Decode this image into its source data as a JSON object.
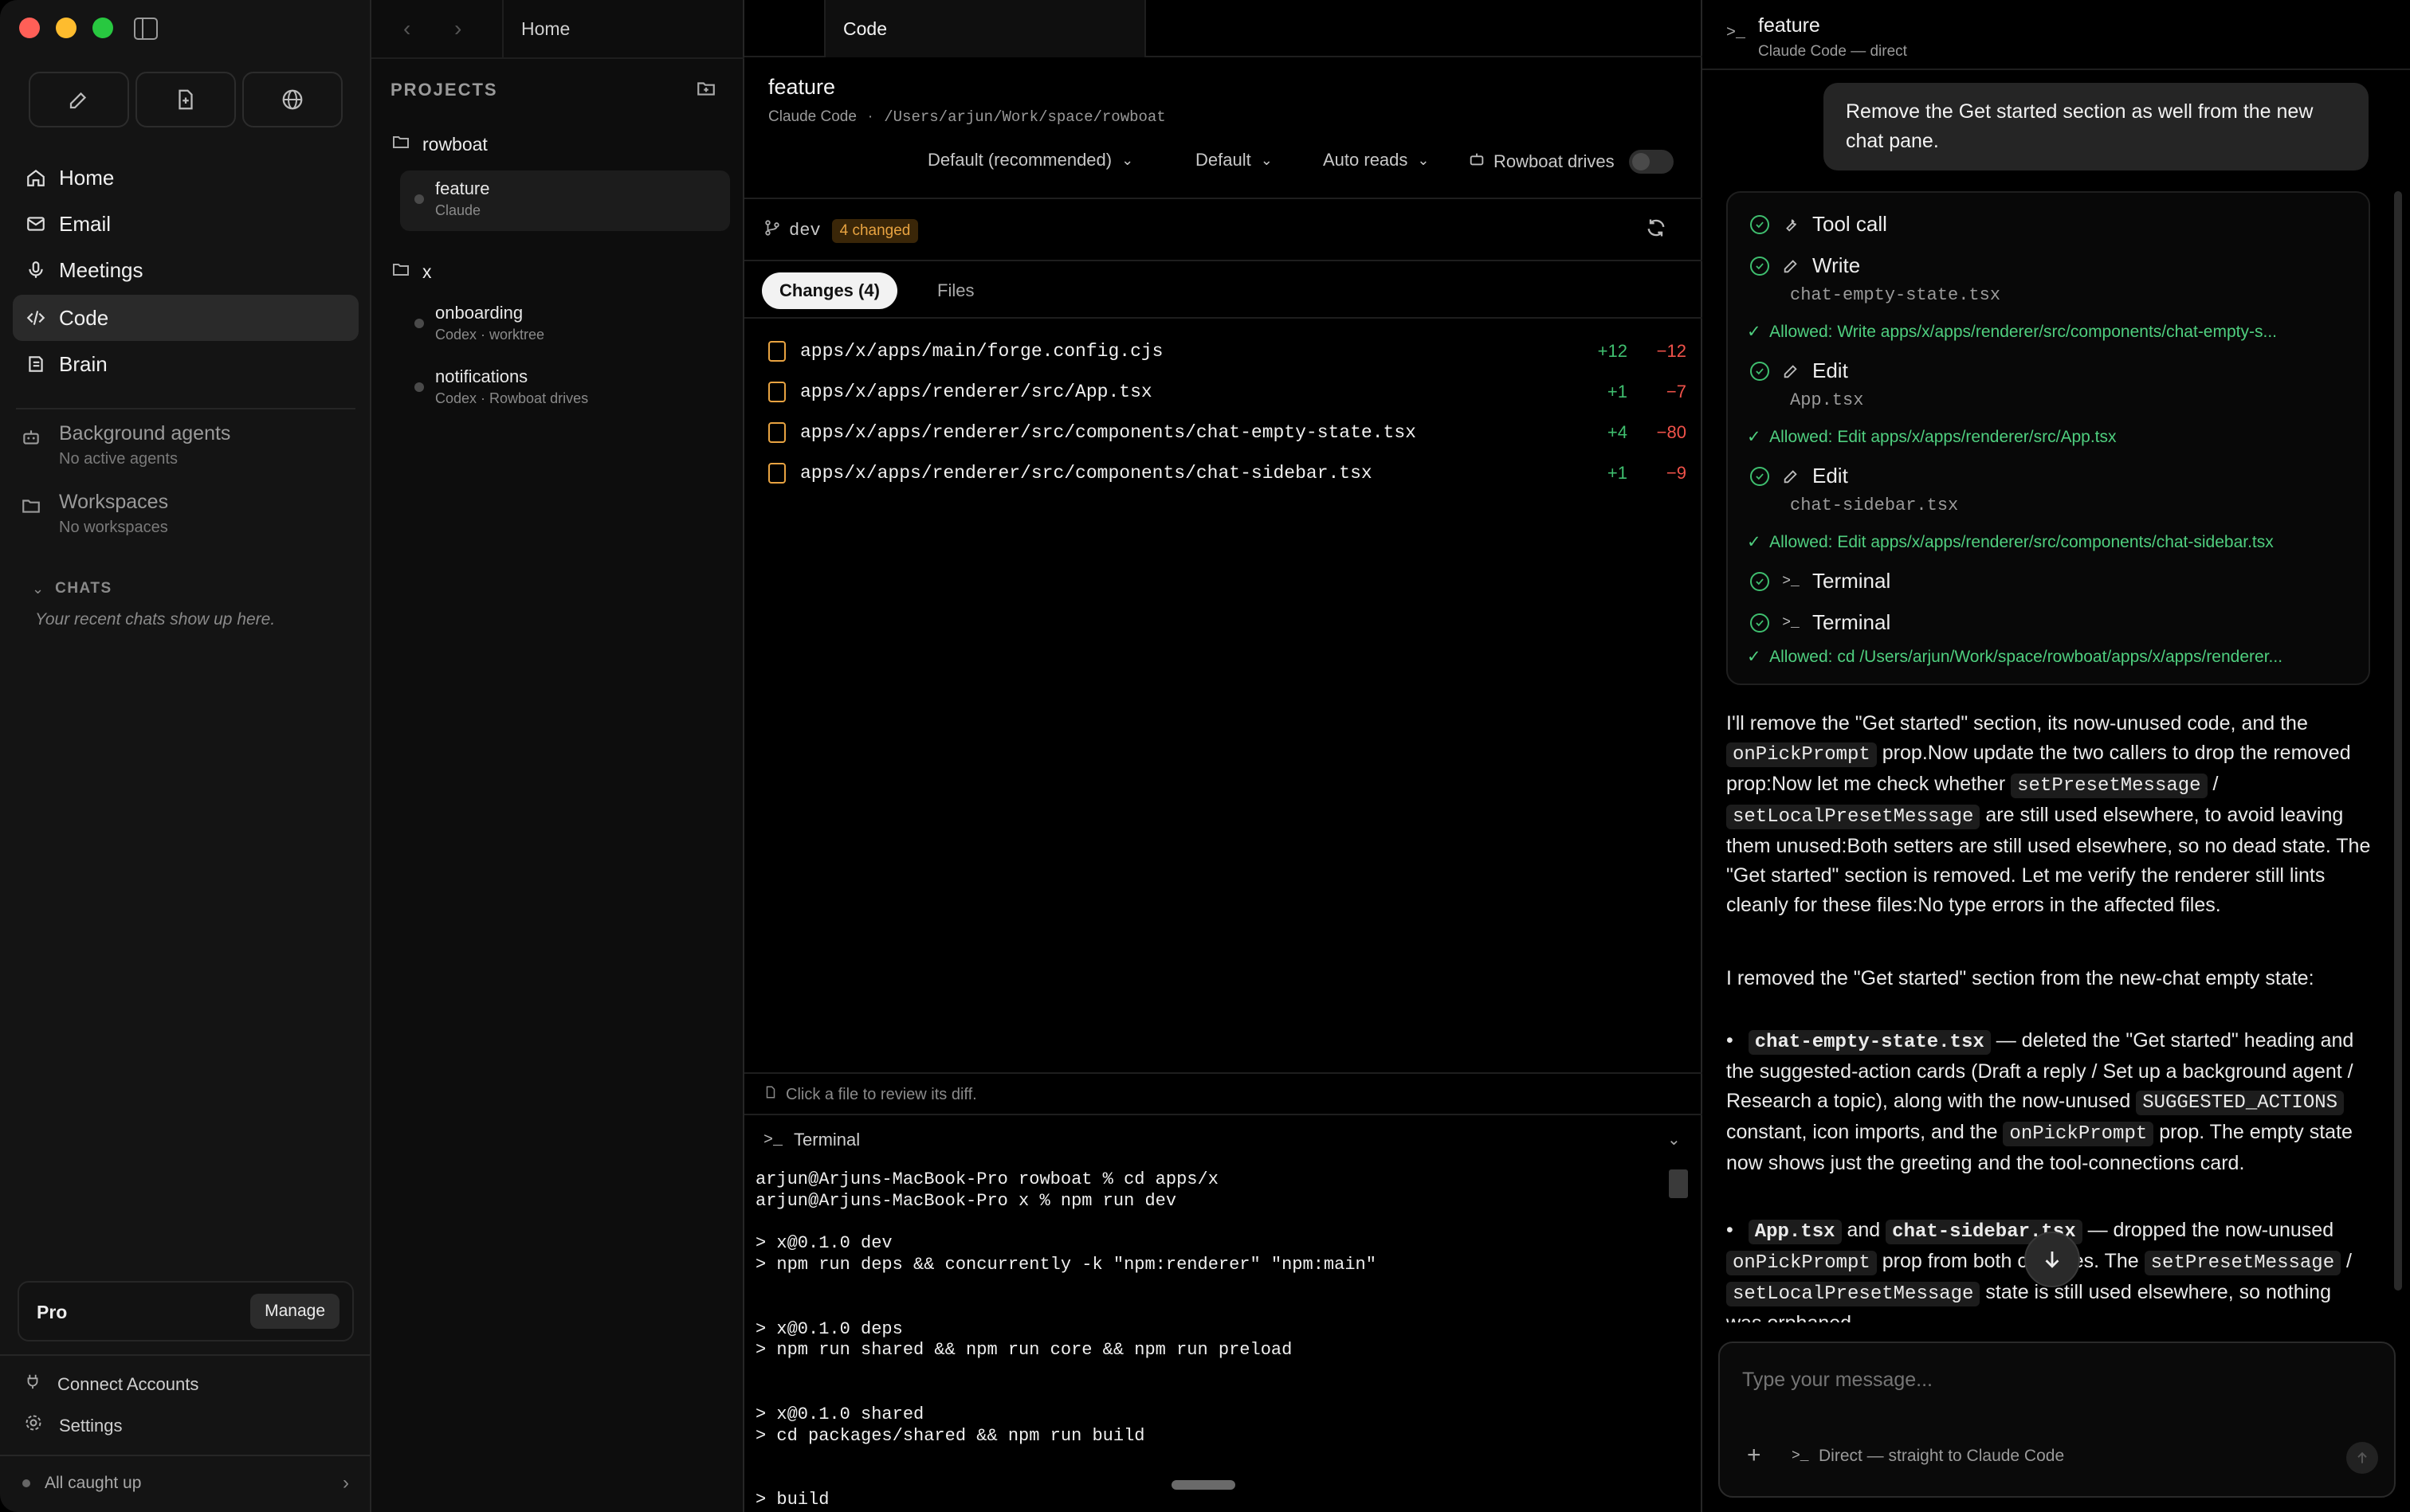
{
  "sidebar": {
    "nav": [
      {
        "label": "Home",
        "icon": "home-icon"
      },
      {
        "label": "Email",
        "icon": "mail-icon"
      },
      {
        "label": "Meetings",
        "icon": "mic-icon"
      },
      {
        "label": "Code",
        "icon": "code-icon"
      },
      {
        "label": "Brain",
        "icon": "book-icon"
      }
    ],
    "background_agents": {
      "title": "Background agents",
      "sub": "No active agents"
    },
    "workspaces": {
      "title": "Workspaces",
      "sub": "No workspaces"
    },
    "chats": {
      "title": "CHATS",
      "empty": "Your recent chats show up here."
    },
    "plan": {
      "name": "Pro",
      "button": "Manage"
    },
    "connect": "Connect Accounts",
    "settings": "Settings",
    "status": "All caught up"
  },
  "tabs": {
    "home": "Home",
    "code": "Code"
  },
  "projects": {
    "title": "PROJECTS",
    "groups": [
      {
        "name": "rowboat",
        "worktrees": [
          {
            "name": "feature",
            "sub": "Claude"
          }
        ]
      },
      {
        "name": "x",
        "worktrees": [
          {
            "name": "onboarding",
            "sub": "Codex · worktree"
          },
          {
            "name": "notifications",
            "sub": "Codex · Rowboat drives"
          }
        ]
      }
    ]
  },
  "session": {
    "title": "feature",
    "agent": "Claude Code",
    "sep": "·",
    "path": "/Users/arjun/Work/space/rowboat",
    "model": "Default (recommended)",
    "mode": "Default",
    "reads": "Auto reads",
    "drives": "Rowboat drives",
    "branch": "dev",
    "changed": "4 changed",
    "tab_changes": "Changes (4)",
    "tab_files": "Files",
    "files": [
      {
        "path": "apps/x/apps/main/forge.config.cjs",
        "add": "+12",
        "del": "−12"
      },
      {
        "path": "apps/x/apps/renderer/src/App.tsx",
        "add": "+1",
        "del": "−7"
      },
      {
        "path": "apps/x/apps/renderer/src/components/chat-empty-state.tsx",
        "add": "+4",
        "del": "−80"
      },
      {
        "path": "apps/x/apps/renderer/src/components/chat-sidebar.tsx",
        "add": "+1",
        "del": "−9"
      }
    ],
    "hint": "Click a file to review its diff."
  },
  "terminal": {
    "title": "Terminal",
    "lines": [
      "arjun@Arjuns-MacBook-Pro rowboat % cd apps/x",
      "arjun@Arjuns-MacBook-Pro x % npm run dev",
      "",
      "> x@0.1.0 dev",
      "> npm run deps && concurrently -k \"npm:renderer\" \"npm:main\"",
      "",
      "",
      "> x@0.1.0 deps",
      "> npm run shared && npm run core && npm run preload",
      "",
      "",
      "> x@0.1.0 shared",
      "> cd packages/shared && npm run build",
      "",
      "",
      "> build"
    ]
  },
  "chat": {
    "title": "feature",
    "subtitle": "Claude Code — direct",
    "user_message": "Remove the Get started section as well from the new chat pane.",
    "tools": {
      "t1": "Tool call",
      "t2": "Write",
      "t2_file": "chat-empty-state.tsx",
      "a1": "Allowed: Write apps/x/apps/renderer/src/components/chat-empty-s...",
      "t3": "Edit",
      "t3_file": "App.tsx",
      "a2": "Allowed: Edit apps/x/apps/renderer/src/App.tsx",
      "t4": "Edit",
      "t4_file": "chat-sidebar.tsx",
      "a3": "Allowed: Edit apps/x/apps/renderer/src/components/chat-sidebar.tsx",
      "t5": "Terminal",
      "t6": "Terminal",
      "a4": "Allowed: cd /Users/arjun/Work/space/rowboat/apps/x/apps/renderer..."
    },
    "p1": {
      "a": "I'll remove the \"Get started\" section, its now-unused code, and the",
      "c1": "onPickPrompt",
      "b": "prop.Now update the two callers to drop the removed prop:Now let me check whether",
      "c2": "setPresetMessage",
      "slash": "/",
      "c3": "setLocalPresetMessage",
      "c": "are still used elsewhere, to avoid leaving them unused:Both setters are still used elsewhere, so no dead state. The \"Get started\" section is removed. Let me verify the renderer still lints cleanly for these files:No type errors in the affected files."
    },
    "p2": "I removed the \"Get started\" section from the new-chat empty state:",
    "bullet1": {
      "file": "chat-empty-state.tsx",
      "a": "— deleted the \"Get started\" heading and the suggested-action cards (Draft a reply / Set up a background agent / Research a topic), along with the now-unused",
      "c1": "SUGGESTED_ACTIONS",
      "b": "constant, icon imports, and the",
      "c2": "onPickPrompt",
      "c": "prop. The empty state now shows just the greeting and the tool-connections card."
    },
    "bullet2": {
      "f1": "App.tsx",
      "and": "and",
      "f2": "chat-sidebar.tsx",
      "a": "— dropped the now-unused",
      "c1": "onPickPrompt",
      "b": "prop from both call sites. The",
      "c2": "setPresetMessage",
      "slash": "/",
      "c3": "setLocalPresetMessage",
      "c": "state is still used elsewhere, so nothing was orphaned."
    },
    "input_placeholder": "Type your message...",
    "footer": "Direct — straight to Claude Code"
  },
  "colors": {
    "accent_green": "#3fbf6f",
    "danger_red": "#f0524a",
    "badge_orange": "#e8a341"
  }
}
